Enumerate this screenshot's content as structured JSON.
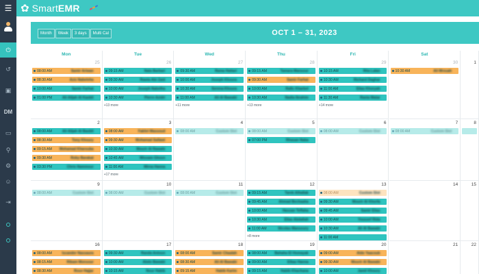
{
  "app": {
    "name_light": "Smart",
    "name_bold": "EMR"
  },
  "sidebar": {
    "items": [
      {
        "icon": "avatar-icon"
      },
      {
        "icon": "power-icon",
        "active": true
      },
      {
        "icon": "history-icon"
      },
      {
        "icon": "briefcase-icon"
      },
      {
        "label": "DM"
      },
      {
        "icon": "wallet-icon"
      },
      {
        "icon": "filter-icon"
      },
      {
        "icon": "settings-icon"
      },
      {
        "icon": "user-icon"
      },
      {
        "icon": "logout-icon"
      },
      {
        "icon": "circle-icon"
      },
      {
        "icon": "circle-icon"
      }
    ]
  },
  "views": [
    "Month",
    "Week",
    "3 days",
    "Multi Cal"
  ],
  "title": "OCT 1 – 31, 2023",
  "dow": [
    "Mon",
    "Tue",
    "Wed",
    "Thu",
    "Fri",
    "Sat",
    ""
  ],
  "weeks": [
    [
      {
        "day": "25",
        "faded": true,
        "events": [
          {
            "t": "08:00 AM",
            "n": "Samir Ariwan",
            "c": "orange"
          },
          {
            "t": "08:30 AM",
            "n": "Aziz Nabeleha",
            "c": "orange"
          },
          {
            "t": "10:00 AM",
            "n": "Samir Farhat",
            "c": "teal"
          },
          {
            "t": "01:00 PM",
            "n": "Ali Alijah Al Kaobli",
            "c": "teal"
          }
        ]
      },
      {
        "day": "26",
        "faded": true,
        "more": "+13 more",
        "events": [
          {
            "t": "09:15 AM",
            "n": "Nala Barbari",
            "c": "teal"
          },
          {
            "t": "09:30 AM",
            "n": "Rawia Abi Zaid",
            "c": "teal"
          },
          {
            "t": "10:00 AM",
            "n": "Joseph Nabelha",
            "c": "teal"
          },
          {
            "t": "10:30 AM",
            "n": "Pierre Azidri",
            "c": "teal"
          }
        ]
      },
      {
        "day": "27",
        "faded": true,
        "more": "+11 more",
        "events": [
          {
            "t": "09:30 AM",
            "n": "Rama Hattari",
            "c": "teal"
          },
          {
            "t": "10:00 AM",
            "n": "Joseph Khoura",
            "c": "teal"
          },
          {
            "t": "10:30 AM",
            "n": "Serena Khoura",
            "c": "teal"
          },
          {
            "t": "11:00 AM",
            "n": "Ali Al Bawabi",
            "c": "teal"
          }
        ]
      },
      {
        "day": "28",
        "faded": true,
        "more": "+13 more",
        "events": [
          {
            "t": "09:15 AM",
            "n": "Tamara Mansour",
            "c": "teal"
          },
          {
            "t": "09:30 AM",
            "n": "Samir Farhat",
            "c": "orange"
          },
          {
            "t": "10:00 AM",
            "n": "Rafic Kharbel",
            "c": "teal"
          },
          {
            "t": "10:30 AM",
            "n": "Nadia Ibrahim",
            "c": "teal"
          }
        ]
      },
      {
        "day": "29",
        "faded": true,
        "more": "+14 more",
        "events": [
          {
            "t": "10:15 AM",
            "n": "Rita Lalan",
            "c": "teal"
          },
          {
            "t": "10:30 AM",
            "n": "Richard Daghar",
            "c": "teal"
          },
          {
            "t": "11:00 AM",
            "n": "Elias Khoryah",
            "c": "teal"
          },
          {
            "t": "11:30 AM",
            "n": "Rania Matar",
            "c": "teal"
          }
        ]
      },
      {
        "day": "30",
        "faded": true,
        "events": [
          {
            "t": "10:30 AM",
            "n": "Ali Mrouah",
            "c": "orange"
          }
        ]
      },
      {
        "day": "1",
        "events": []
      }
    ],
    [
      {
        "day": "2",
        "events": [
          {
            "t": "08:00 AM",
            "n": "Ali Alijah Al Baobli",
            "c": "teal"
          },
          {
            "t": "08:30 AM",
            "n": "Tony Khoury",
            "c": "orange"
          },
          {
            "t": "09:15 AM",
            "n": "Mohamad Kharouba",
            "c": "orange"
          },
          {
            "t": "09:30 AM",
            "n": "Roby Barakat",
            "c": "orange"
          },
          {
            "t": "03:30 PM",
            "n": "Chris Nammour",
            "c": "teal"
          }
        ]
      },
      {
        "day": "3",
        "more": "+17 more",
        "events": [
          {
            "t": "08:00 AM",
            "n": "Fakhri Massoud",
            "c": "orange"
          },
          {
            "t": "09:30 AM",
            "n": "Mohamad Sallawi",
            "c": "orange"
          },
          {
            "t": "10:30 AM",
            "n": "Mourir Al Rawahi",
            "c": "teal"
          },
          {
            "t": "10:45 AM",
            "n": "Wissam Ghosn",
            "c": "teal"
          },
          {
            "t": "11:00 AM",
            "n": "Mirna Hanna",
            "c": "teal"
          }
        ]
      },
      {
        "day": "4",
        "events": [
          {
            "t": "08:00 AM",
            "n": "Custom Slot",
            "c": "faded-teal"
          }
        ]
      },
      {
        "day": "5",
        "events": [
          {
            "t": "08:00 AM",
            "n": "Custom Slot",
            "c": "faded-teal"
          },
          {
            "t": "07:00 PM",
            "n": "Rhasan Naba",
            "c": "teal"
          }
        ]
      },
      {
        "day": "6",
        "events": [
          {
            "t": "08:00 AM",
            "n": "Custom Slot",
            "c": "faded-teal"
          }
        ]
      },
      {
        "day": "7",
        "events": [
          {
            "t": "08:00 AM",
            "n": "Custom Slot",
            "c": "faded-teal"
          }
        ]
      },
      {
        "day": "8",
        "events": [
          {
            "t": "",
            "n": "",
            "c": "faded-teal"
          }
        ]
      }
    ],
    [
      {
        "day": "9",
        "events": [
          {
            "t": "08:00 AM",
            "n": "Custom Slot",
            "c": "faded-teal"
          }
        ]
      },
      {
        "day": "10",
        "events": [
          {
            "t": "08:00 AM",
            "n": "Custom Slot",
            "c": "faded-teal"
          }
        ]
      },
      {
        "day": "11",
        "events": [
          {
            "t": "08:00 AM",
            "n": "Custom Slot",
            "c": "faded-teal"
          }
        ]
      },
      {
        "day": "12",
        "more": "+8 more",
        "events": [
          {
            "t": "09:15 AM",
            "n": "Tarek Alhallak",
            "c": "teal"
          },
          {
            "t": "09:45 AM",
            "n": "Ahmad Bechaaha",
            "c": "teal"
          },
          {
            "t": "10:00 AM",
            "n": "Hassan Teffaha",
            "c": "teal"
          },
          {
            "t": "10:30 AM",
            "n": "Elias Abdallah",
            "c": "teal"
          },
          {
            "t": "11:00 AM",
            "n": "Nicolas Mansoury",
            "c": "teal"
          }
        ]
      },
      {
        "day": "13",
        "events": [
          {
            "t": "08:00 AM",
            "n": "Custom Slot",
            "c": "faded-orange"
          },
          {
            "t": "09:30 AM",
            "n": "Mourir Al Khorfa",
            "c": "teal"
          },
          {
            "t": "09:45 AM",
            "n": "Samir Elias",
            "c": "teal"
          },
          {
            "t": "10:00 AM",
            "n": "Youssef Rida",
            "c": "teal"
          },
          {
            "t": "10:30 AM",
            "n": "Ali Al Bawabi",
            "c": "teal"
          },
          {
            "t": "11:00 AM",
            "n": "",
            "c": "teal"
          }
        ]
      },
      {
        "day": "14",
        "events": []
      },
      {
        "day": "15",
        "events": []
      }
    ],
    [
      {
        "day": "16",
        "events": [
          {
            "t": "08:00 AM",
            "n": "Iscander Nassaura",
            "c": "orange"
          },
          {
            "t": "08:15 AM",
            "n": "Ribam Monsour",
            "c": "orange"
          },
          {
            "t": "08:30 AM",
            "n": "Rose Hajjar",
            "c": "orange"
          }
        ]
      },
      {
        "day": "17",
        "events": [
          {
            "t": "09:30 AM",
            "n": "Randa Antoun",
            "c": "teal"
          },
          {
            "t": "10:00 AM",
            "n": "Abdo Bawabi",
            "c": "teal"
          },
          {
            "t": "10:15 AM",
            "n": "Nour Habib",
            "c": "teal"
          }
        ]
      },
      {
        "day": "18",
        "events": [
          {
            "t": "08:00 AM",
            "n": "Samir Chaalah",
            "c": "orange"
          },
          {
            "t": "08:30 AM",
            "n": "Ali Al Bawabi",
            "c": "orange"
          },
          {
            "t": "09:15 AM",
            "n": "Habib Karim",
            "c": "orange"
          }
        ]
      },
      {
        "day": "19",
        "events": [
          {
            "t": "08:00 AM",
            "n": "Bahaha El Homayak",
            "c": "teal"
          },
          {
            "t": "09:00 AM",
            "n": "Elbaz Hanna",
            "c": "teal"
          },
          {
            "t": "09:15 AM",
            "n": "Habib Khachana",
            "c": "teal"
          }
        ]
      },
      {
        "day": "20",
        "events": [
          {
            "t": "09:00 AM",
            "n": "Aldo Yaacoub",
            "c": "orange"
          },
          {
            "t": "09:30 AM",
            "n": "Mourir Al Bawabi",
            "c": "orange"
          },
          {
            "t": "10:00 AM",
            "n": "Jamil Khoury",
            "c": "teal"
          }
        ]
      },
      {
        "day": "21",
        "events": []
      },
      {
        "day": "22",
        "events": []
      }
    ]
  ]
}
